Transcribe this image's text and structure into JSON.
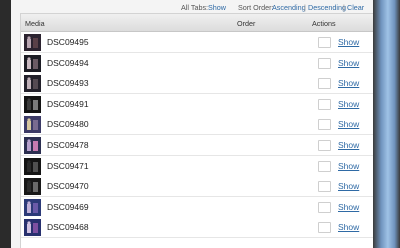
{
  "colors": {
    "link": "#2f6aa5",
    "panel_bg": "#f4f4f4",
    "header_bg": "#e6e6e6"
  },
  "toolbar": {
    "all_tabs_label": "All Tabs:",
    "show_label": "Show",
    "sort_order_label": "Sort Order:",
    "ascending_label": "Ascending",
    "separator": "|",
    "descending_label": "Descending",
    "clear_label": "Clear"
  },
  "table": {
    "headers": {
      "media": "Media",
      "order": "Order",
      "actions": "Actions"
    },
    "rows": [
      {
        "name": "DSC09495",
        "thumb": "photo-thumbnail-icon",
        "action": "Show"
      },
      {
        "name": "DSC09494",
        "thumb": "photo-thumbnail-icon",
        "action": "Show"
      },
      {
        "name": "DSC09493",
        "thumb": "photo-thumbnail-icon",
        "action": "Show"
      },
      {
        "name": "DSC09491",
        "thumb": "photo-thumbnail-icon",
        "action": "Show"
      },
      {
        "name": "DSC09480",
        "thumb": "photo-thumbnail-icon",
        "action": "Show"
      },
      {
        "name": "DSC09478",
        "thumb": "photo-thumbnail-icon",
        "action": "Show"
      },
      {
        "name": "DSC09471",
        "thumb": "photo-thumbnail-icon",
        "action": "Show"
      },
      {
        "name": "DSC09470",
        "thumb": "photo-thumbnail-icon",
        "action": "Show"
      },
      {
        "name": "DSC09469",
        "thumb": "photo-thumbnail-icon",
        "action": "Show"
      },
      {
        "name": "DSC09468",
        "thumb": "photo-thumbnail-icon",
        "action": "Show"
      }
    ]
  }
}
